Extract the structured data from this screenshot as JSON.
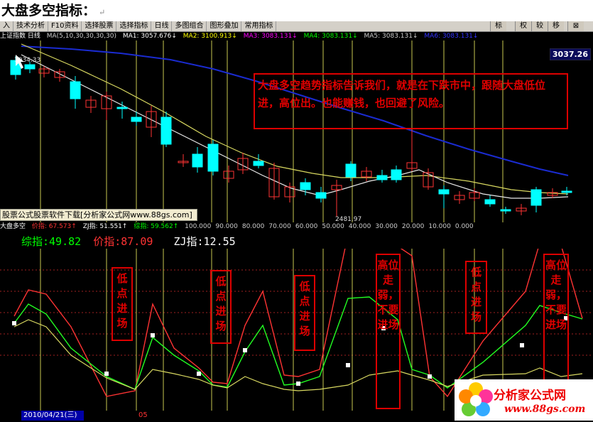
{
  "doc_title": "大盘多空指标：",
  "doc_return_mark": "↵",
  "menu": {
    "items": [
      "入",
      "技术分析",
      "F10资料",
      "选择股票",
      "选择指标",
      "日线",
      "多图组合",
      "图形叠加",
      "常用指标"
    ],
    "right_buttons": [
      "标",
      "权",
      "较",
      "移",
      "⊠"
    ]
  },
  "chart_header": {
    "name": "上证指数 日线",
    "ma_params": "MA(5,10,30,30,30,30)",
    "ma": [
      {
        "label": "MA1: 3057.676↓",
        "color": "#ffffff"
      },
      {
        "label": "MA2: 3100.913↓",
        "color": "#ffff00"
      },
      {
        "label": "MA3: 3083.131↓",
        "color": "#ff00ff"
      },
      {
        "label": "MA4: 3083.131↓",
        "color": "#00ff00"
      },
      {
        "label": "MA5: 3083.131↓",
        "color": "#cccccc"
      },
      {
        "label": "MA6: 3083.131↓",
        "color": "#3333ff"
      }
    ]
  },
  "price_tag": "3037.26",
  "high_label": "3034.33",
  "low_label": "2481.97",
  "callout": "大盘多空趋势指标告诉我们，就是在下跌市中，跟随大盘低位进，高位出。也能赚钱，也回避了风险。",
  "ad_banner": "股票公式股票软件下载[分析家公式网www.88gs.com]",
  "indicator_header": {
    "name": "大盘多空",
    "values": [
      {
        "label": "价指: 67.573↑",
        "color": "#ff3333"
      },
      {
        "label": "ZJ指: 51.551↑",
        "color": "#ffffff"
      },
      {
        "label": "综指: 59.562↑",
        "color": "#00ff00"
      }
    ],
    "scale": [
      "100.000",
      "90.000",
      "80.000",
      "70.000",
      "60.000",
      "50.000",
      "40.000",
      "30.000",
      "20.000",
      "10.000",
      "0.000"
    ]
  },
  "indicator_values": [
    {
      "label": "综指:49.82",
      "color": "#00ff00"
    },
    {
      "label": "价指:87.09",
      "color": "#ff3333"
    },
    {
      "label": "ZJ指:12.55",
      "color": "#ffffff"
    }
  ],
  "signals": [
    "低点进场",
    "低点进场",
    "低点进场",
    "高位走弱，不要进场",
    "低点进场",
    "高位走弱，不要进场"
  ],
  "date": "2010/04/21(三)",
  "axis_mark": "05",
  "logo": {
    "name": "分析家公式网",
    "url": "www.88gs.com"
  },
  "colors": {
    "callout": "#e00000",
    "up": "#ff3333",
    "down": "#00ffff",
    "ma_slow": "#1a2bd0",
    "ma_mid": "#d8d860",
    "ma_fast": "#e8e8e8"
  }
}
